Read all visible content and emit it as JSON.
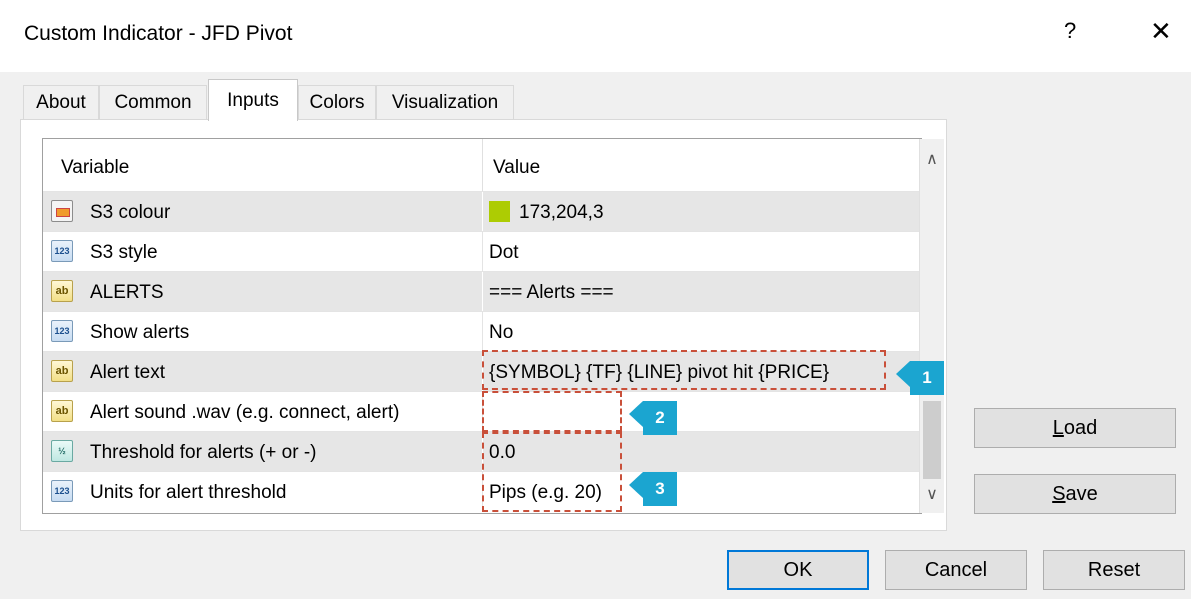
{
  "window": {
    "title": "Custom Indicator - JFD Pivot",
    "help_label": "?",
    "close_label": "✕"
  },
  "tabs": [
    {
      "label": "About"
    },
    {
      "label": "Common"
    },
    {
      "label": "Inputs",
      "active": true
    },
    {
      "label": "Colors"
    },
    {
      "label": "Visualization"
    }
  ],
  "grid": {
    "header": {
      "variable": "Variable",
      "value": "Value"
    },
    "rows": [
      {
        "icon": "color-icon",
        "name": "S3 colour",
        "value": "173,204,3",
        "swatch_color": "#adcc03"
      },
      {
        "icon": "123-icon",
        "icon_text": "123",
        "name": "S3 style",
        "value": "Dot"
      },
      {
        "icon": "ab-icon",
        "icon_text": "ab",
        "name": "ALERTS",
        "value": "=== Alerts ==="
      },
      {
        "icon": "123-icon",
        "icon_text": "123",
        "name": "Show alerts",
        "value": "No"
      },
      {
        "icon": "ab-icon",
        "icon_text": "ab",
        "name": "Alert text",
        "value": "{SYMBOL} {TF} {LINE} pivot hit {PRICE}"
      },
      {
        "icon": "ab-icon",
        "icon_text": "ab",
        "name": "Alert sound .wav (e.g. connect, alert)",
        "value": ""
      },
      {
        "icon": "half-icon",
        "icon_text": "½",
        "name": "Threshold for alerts (+ or -)",
        "value": "0.0"
      },
      {
        "icon": "123-icon",
        "icon_text": "123",
        "name": "Units for alert threshold",
        "value": "Pips (e.g. 20)"
      }
    ]
  },
  "scrollbar": {
    "up": "∧",
    "down": "∨"
  },
  "annotations": [
    {
      "label": "1"
    },
    {
      "label": "2"
    },
    {
      "label": "3"
    }
  ],
  "side_buttons": {
    "load_first": "L",
    "load_rest": "oad",
    "save_first": "S",
    "save_rest": "ave"
  },
  "footer_buttons": {
    "ok": "OK",
    "cancel": "Cancel",
    "reset": "Reset"
  },
  "colors": {
    "accent": "#0078d7",
    "annotation_badge": "#1ba5d0",
    "annotation_border": "#c9503a"
  }
}
